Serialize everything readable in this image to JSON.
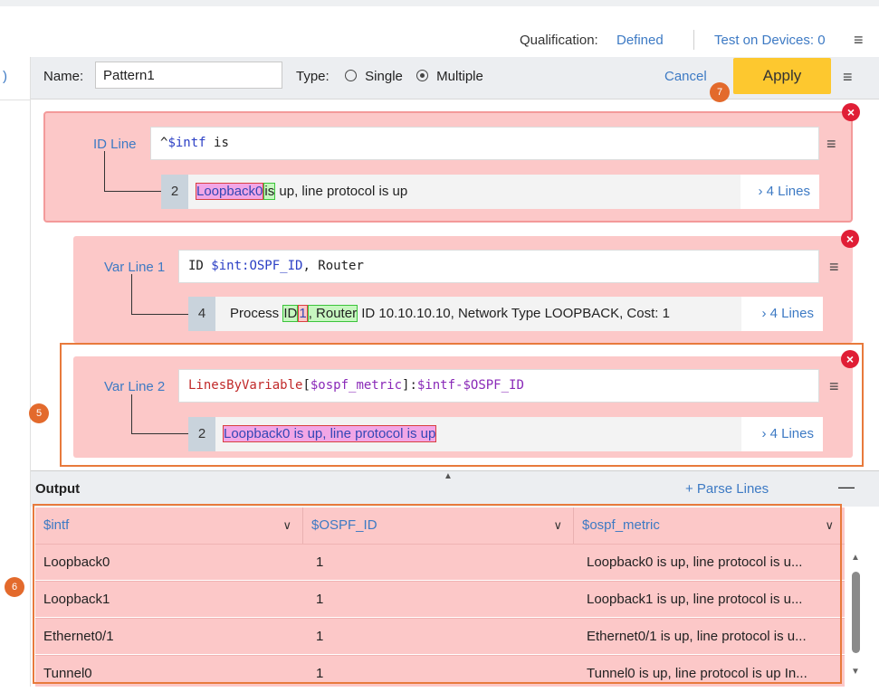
{
  "header": {
    "qualification_label": "Qualification:",
    "qualification_value": "Defined",
    "test_link": "Test on Devices: 0"
  },
  "left": {
    "fragment": ")"
  },
  "toolbar": {
    "name_label": "Name:",
    "name_value": "Pattern1",
    "type_label": "Type:",
    "type_options": [
      "Single",
      "Multiple"
    ],
    "type_selected": "Multiple",
    "cancel_label": "Cancel",
    "apply_label": "Apply"
  },
  "markers": {
    "m5": "5",
    "m6": "6",
    "m7": "7"
  },
  "lines": [
    {
      "label": "ID Line",
      "expression": {
        "p1": "^",
        "p2": "$intf",
        "p3": " is"
      },
      "sample": {
        "num": "2",
        "h1": "Loopback0",
        "h2": "is",
        "rest": " up, line protocol is up"
      },
      "more": "4 Lines"
    },
    {
      "label": "Var Line 1",
      "expression": {
        "p1": "ID ",
        "p2": "$int:OSPF_ID",
        "p3": ", Router"
      },
      "sample": {
        "num": "4",
        "pre": "Process ",
        "h1": "ID",
        "h2": "1",
        "h3": ", Router",
        "rest": " ID 10.10.10.10, Network Type LOOPBACK, Cost: 1"
      },
      "more": "4 Lines"
    },
    {
      "label": "Var Line 2",
      "expression": {
        "p1": "LinesByVariable",
        "p2": "[",
        "p3": "$ospf_metric",
        "p4": "]:",
        "p5": "$intf-$OSPF_ID"
      },
      "sample": {
        "num": "2",
        "h1": "Loopback0 is up, line protocol is up"
      },
      "more": "4 Lines"
    }
  ],
  "output": {
    "title": "Output",
    "parse_link": "+ Parse Lines",
    "columns": [
      "$intf",
      "$OSPF_ID",
      "$ospf_metric"
    ],
    "rows": [
      [
        "Loopback0",
        "1",
        "Loopback0 is up, line protocol is u..."
      ],
      [
        "Loopback1",
        "1",
        "Loopback1 is up, line protocol is u..."
      ],
      [
        "Ethernet0/1",
        "1",
        "Ethernet0/1 is up, line protocol is u..."
      ],
      [
        "Tunnel0",
        "1",
        "Tunnel0 is up, line protocol is up In..."
      ]
    ]
  },
  "colors": {
    "accent": "#3d7ac4",
    "apply": "#fdc82f",
    "panel_pink": "#fcc8c8",
    "error": "#e01e36",
    "marker": "#e36a2c"
  }
}
